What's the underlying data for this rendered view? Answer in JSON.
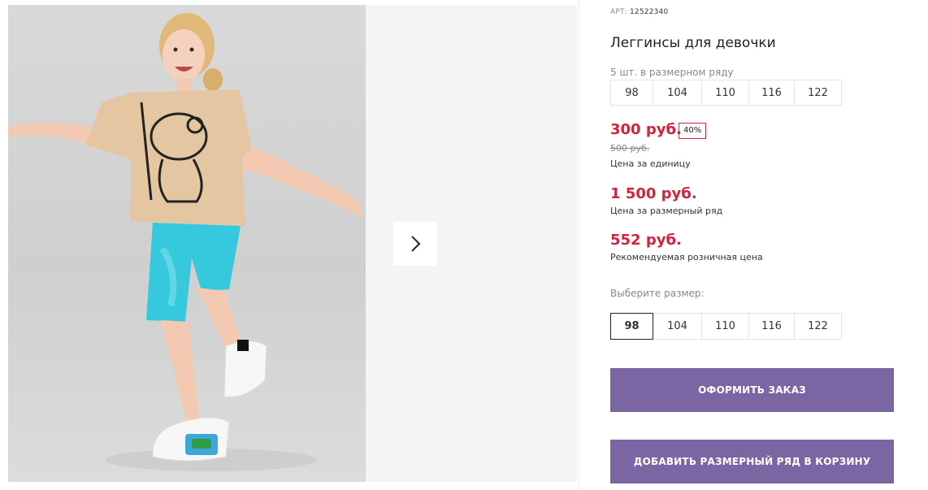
{
  "product": {
    "article_label": "АРТ:",
    "article": "12522340",
    "title": "Леггинсы для девочки"
  },
  "pack": {
    "note": "5 шт. в размерном ряду",
    "sizes": [
      "98",
      "104",
      "110",
      "116",
      "122"
    ]
  },
  "prices": {
    "unit_price": "300 руб.",
    "discount": "40%",
    "old_price": "500 руб.",
    "unit_caption": "Цена за единицу",
    "pack_price": "1 500 руб.",
    "pack_caption": "Цена за размерный ряд",
    "retail_price": "552 руб.",
    "retail_caption": "Рекомендуемая розничная цена"
  },
  "size_select": {
    "label": "Выберите размер:",
    "options": [
      "98",
      "104",
      "110",
      "116",
      "122"
    ],
    "selected": "98"
  },
  "actions": {
    "order_label": "ОФОРМИТЬ ЗАКАЗ",
    "add_pack_label": "ДОБАВИТЬ РАЗМЕРНЫЙ РЯД В КОРЗИНУ"
  },
  "gallery": {
    "next_icon": "chevron-right-icon"
  },
  "colors": {
    "accent": "#7b66a4",
    "price_red": "#d6203c"
  }
}
